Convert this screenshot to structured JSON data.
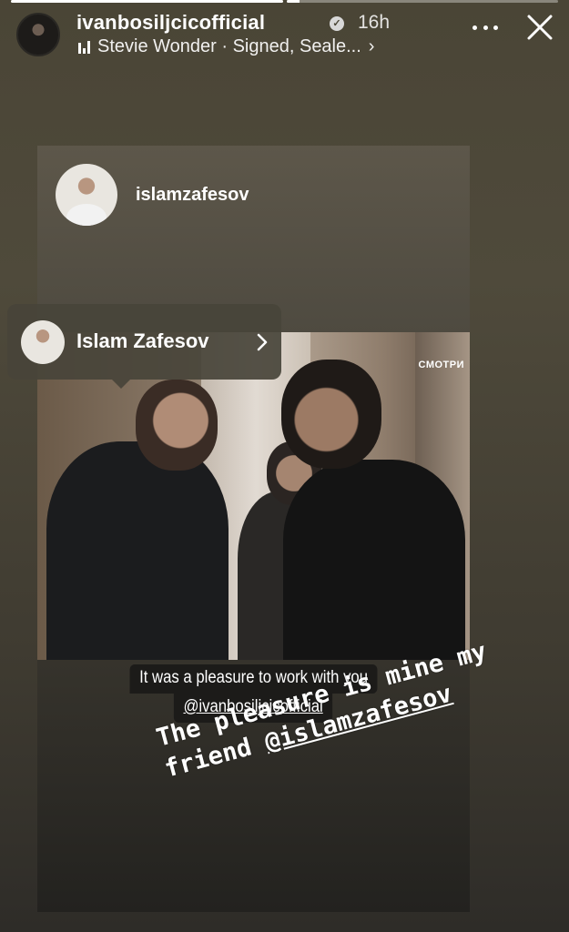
{
  "story": {
    "progress": [
      1.0,
      0.05
    ],
    "username": "ivanbosiljcicofficial",
    "verified_glyph": "✓",
    "time": "16h",
    "music": "Stevie Wonder · Signed, Seale...",
    "music_chevron": "›"
  },
  "icons": {
    "verified": "verified-badge-icon",
    "music": "music-bars-icon",
    "more": "more-options-icon",
    "close": "close-icon"
  },
  "shared_post": {
    "username": "islamzafesov",
    "watermark": "СМОТРИ",
    "caption_line1": "It was a pleasure to work with you",
    "caption_line2": "@ivanbosiljcicofficial"
  },
  "tag": {
    "name": "Islam Zafesov"
  },
  "overlay": {
    "line1": "The pleasure is mine my",
    "line2_prefix": "friend ",
    "mention": "@islamzafesov"
  }
}
